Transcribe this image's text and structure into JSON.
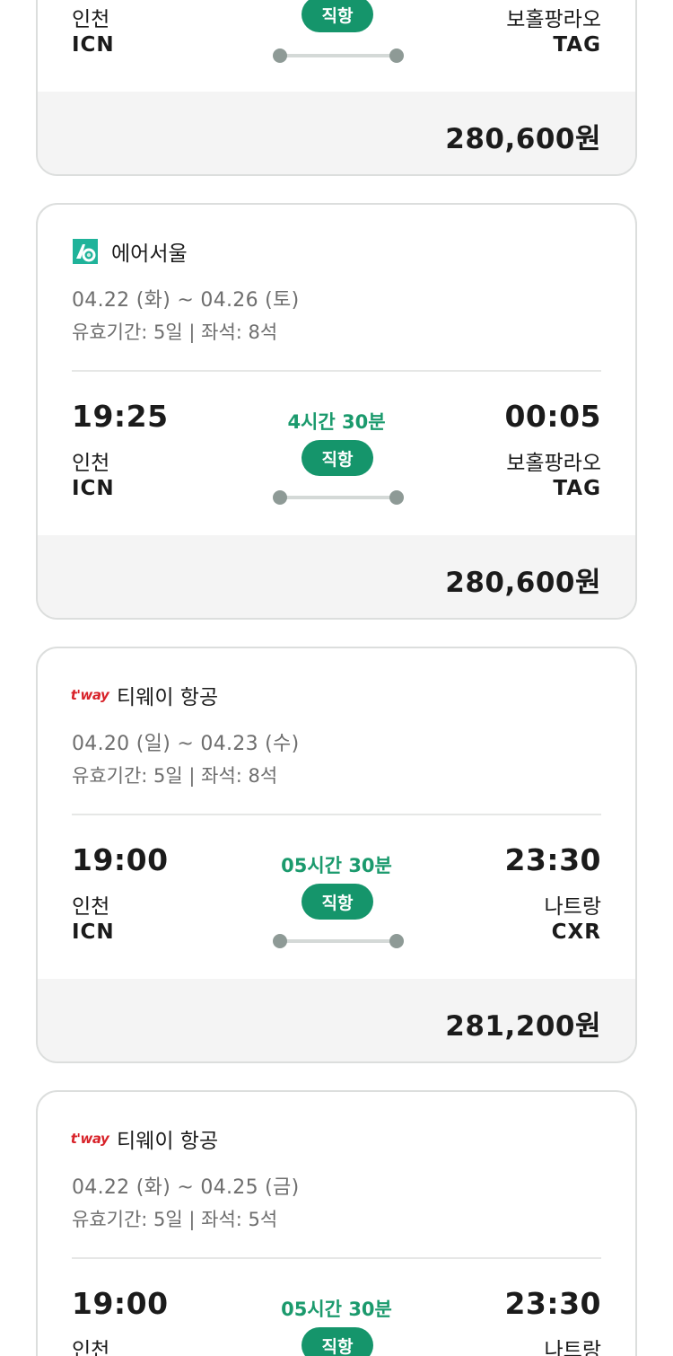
{
  "card0": {
    "depart_city": "인천",
    "depart_code": "ICN",
    "nonstop": "직항",
    "arrive_city": "보홀팡라오",
    "arrive_code": "TAG",
    "price": "280,600원"
  },
  "card1": {
    "airline": "에어서울",
    "logo": "air-seoul-logo",
    "dates": "04.22 (화) ~ 04.26 (토)",
    "validity": "유효기간: 5일 | 좌석: 8석",
    "depart_time": "19:25",
    "depart_city": "인천",
    "depart_code": "ICN",
    "duration": "4시간 30분",
    "nonstop": "직항",
    "arrive_time": "00:05",
    "arrive_city": "보홀팡라오",
    "arrive_code": "TAG",
    "price": "280,600원"
  },
  "card2": {
    "airline": "티웨이 항공",
    "logo_text": "t'way",
    "dates": "04.20 (일) ~ 04.23 (수)",
    "validity": "유효기간: 5일 | 좌석: 8석",
    "depart_time": "19:00",
    "depart_city": "인천",
    "depart_code": "ICN",
    "duration": "05시간 30분",
    "nonstop": "직항",
    "arrive_time": "23:30",
    "arrive_city": "나트랑",
    "arrive_code": "CXR",
    "price": "281,200원"
  },
  "card3": {
    "airline": "티웨이 항공",
    "logo_text": "t'way",
    "dates": "04.22 (화) ~ 04.25 (금)",
    "validity": "유효기간: 5일 | 좌석: 5석",
    "depart_time": "19:00",
    "depart_city": "인천",
    "duration": "05시간 30분",
    "nonstop": "직항",
    "arrive_time": "23:30",
    "arrive_city": "나트랑"
  },
  "colors": {
    "accent_green": "#15956b",
    "duration_green": "#1b9a6d",
    "tway_red": "#d8232a",
    "airseoul_teal": "#1fb39a"
  }
}
